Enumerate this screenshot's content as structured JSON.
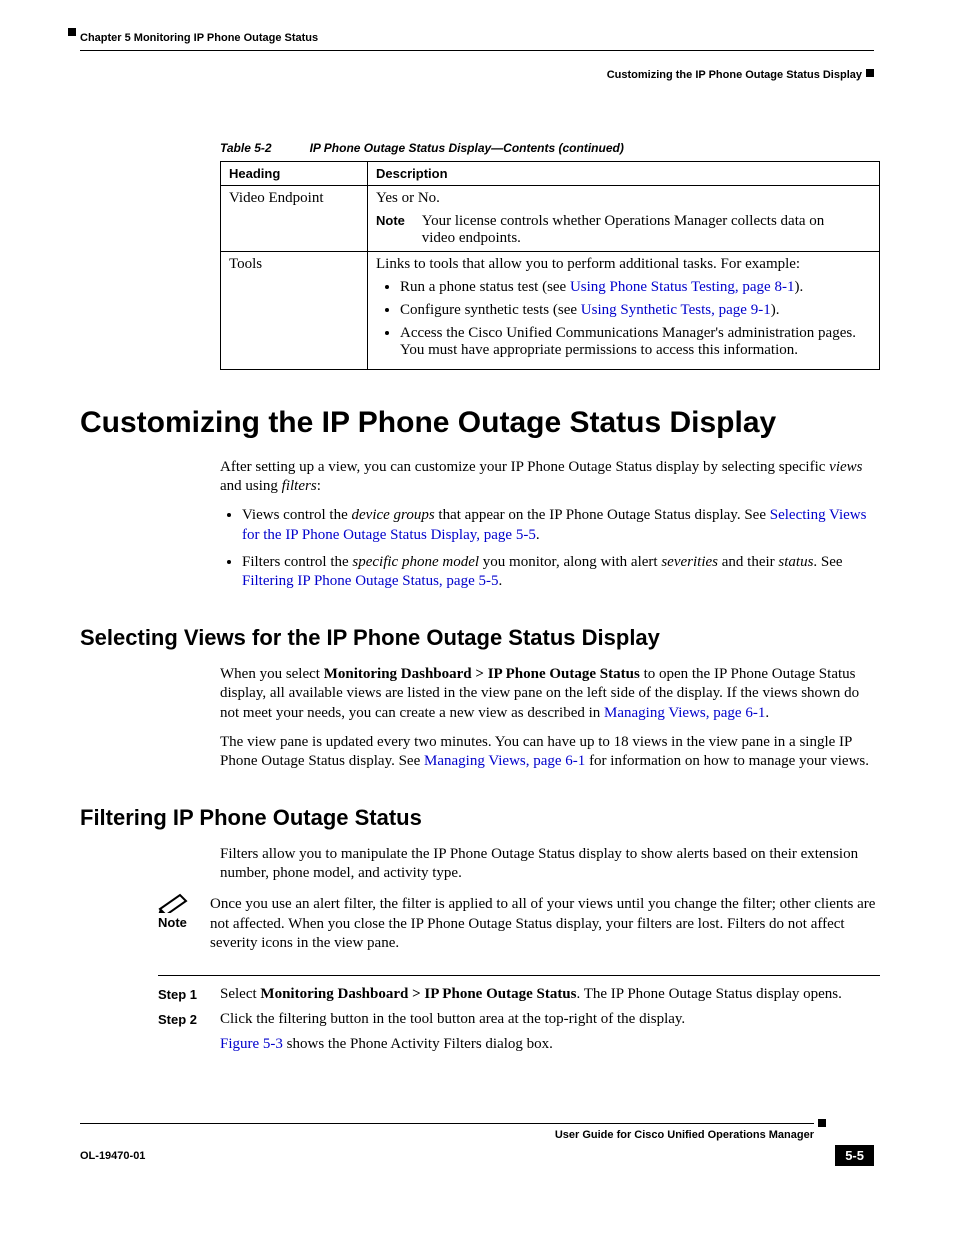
{
  "header": {
    "chapter_line": "Chapter 5      Monitoring IP Phone Outage Status",
    "section_line": "Customizing the IP Phone Outage Status Display"
  },
  "table": {
    "caption_num": "Table 5-2",
    "caption_title": "IP Phone Outage Status Display—Contents (continued)",
    "col1": "Heading",
    "col2": "Description",
    "rows": {
      "video": {
        "heading": "Video Endpoint",
        "line1": "Yes or No.",
        "note_label": "Note",
        "note_body": "Your license controls whether Operations Manager collects data on video endpoints."
      },
      "tools": {
        "heading": "Tools",
        "line1": "Links to tools that allow you to perform additional tasks. For example:",
        "b1a": "Run a phone status test (see ",
        "b1link": "Using Phone Status Testing, page 8-1",
        "b1b": ").",
        "b2a": "Configure synthetic tests (see ",
        "b2link": "Using Synthetic Tests, page 9-1",
        "b2b": ").",
        "b3": "Access the Cisco Unified Communications Manager's administration pages. You must have appropriate permissions to access this information."
      }
    }
  },
  "h1": "Customizing the IP Phone Outage Status Display",
  "intro": {
    "p1a": "After setting up a view, you can customize your IP Phone Outage Status display by selecting specific ",
    "p1_em1": "views",
    "p1b": " and using ",
    "p1_em2": "filters",
    "p1c": ":",
    "li1a": "Views control the ",
    "li1_em": "device groups",
    "li1b": " that appear on the IP Phone Outage Status display. See ",
    "li1_link": "Selecting Views for the IP Phone Outage Status Display, page 5-5",
    "li1c": ".",
    "li2a": "Filters control the ",
    "li2_em1": "specific phone model",
    "li2b": " you monitor, along with alert ",
    "li2_em2": "severities",
    "li2c": " and their ",
    "li2_em3": "status",
    "li2d": ". See ",
    "li2_link": "Filtering IP Phone Outage Status, page 5-5",
    "li2e": "."
  },
  "sub1": {
    "title": "Selecting Views for the IP Phone Outage Status Display",
    "p1a": "When you select ",
    "p1_bold": "Monitoring Dashboard > IP Phone Outage Status",
    "p1b": " to open the IP Phone Outage Status display, all available views are listed in the view pane on the left side of the display. If the views shown do not meet your needs, you can create a new view as described in ",
    "p1_link": "Managing Views, page 6-1",
    "p1c": ".",
    "p2a": "The view pane is updated every two minutes. You can have up to 18 views in the view pane in a single IP Phone Outage Status display. See ",
    "p2_link": "Managing Views, page 6-1",
    "p2b": " for information on how to manage your views."
  },
  "sub2": {
    "title": "Filtering IP Phone Outage Status",
    "p1": "Filters allow you to manipulate the IP Phone Outage Status display to show alerts based on their extension number, phone model, and activity type.",
    "note_label": "Note",
    "note_body": "Once you use an alert filter, the filter is applied to all of your views until you change the filter; other clients are not affected. When you close the IP Phone Outage Status display, your filters are lost. Filters do not affect severity icons in the view pane.",
    "step1_lbl": "Step 1",
    "step1a": "Select ",
    "step1_bold": "Monitoring Dashboard > IP Phone Outage Status",
    "step1b": ". The IP Phone Outage Status display opens.",
    "step2_lbl": "Step 2",
    "step2": "Click the filtering button in the tool button area at the top-right of the display.",
    "fig_a": "Figure 5-3",
    "fig_b": " shows the Phone Activity Filters dialog box."
  },
  "footer": {
    "guide": "User Guide for Cisco Unified Operations Manager",
    "doc": "OL-19470-01",
    "page": "5-5"
  }
}
